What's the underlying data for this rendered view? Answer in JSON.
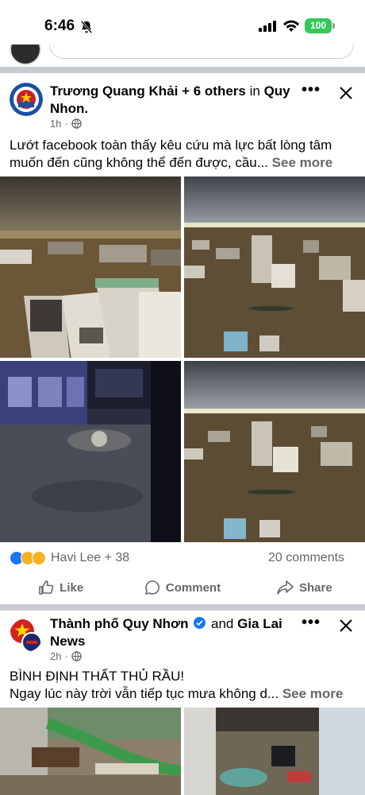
{
  "status_bar": {
    "time": "6:46",
    "battery": "100"
  },
  "post1": {
    "author": "Trương Quang Khải + 6 others",
    "in_word": "in",
    "location": "Quy Nhon.",
    "time": "1h",
    "text": "Lướt facebook toàn thấy kêu cứu mà lực bất lòng tâm muốn đến cũng không thể đến được, cầu...",
    "see_more": "See more",
    "reactions_label": "Havi Lee + 38",
    "comments": "20 comments",
    "actions": {
      "like": "Like",
      "comment": "Comment",
      "share": "Share"
    }
  },
  "post2": {
    "author": "Thành phố Quy Nhơn",
    "and_word": "and",
    "coauthor": "Gia Lai News",
    "time": "2h",
    "text_line1": "BÌNH ĐỊNH THẤT THỦ RẦU!",
    "text_line2": "Ngay lúc này trời vẫn tiếp tục mưa không d...",
    "see_more": "See more"
  },
  "icons": [
    "bell-slash-icon",
    "signal-icon",
    "wifi-icon",
    "battery-icon",
    "more-dots-icon",
    "close-icon",
    "globe-icon",
    "like-icon",
    "comment-icon",
    "share-icon",
    "verified-icon"
  ],
  "colors": {
    "accent": "#1877f2",
    "battery": "#34c759",
    "secondary_text": "#65676b"
  }
}
